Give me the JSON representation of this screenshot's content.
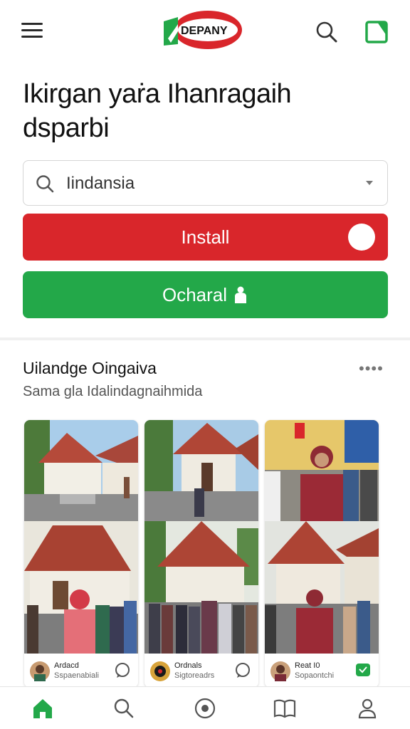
{
  "header": {
    "logo_text": "DEPANY",
    "menu_icon": "hamburger-menu-icon",
    "search_icon": "search-icon",
    "bookmark_icon": "bookmark-icon"
  },
  "page": {
    "title_line1": "Ikirgan yaṙa Ihanragaih",
    "title_line2": "dsparbi"
  },
  "select": {
    "value": "Iindansia",
    "icon": "search-icon"
  },
  "buttons": {
    "install_label": "Install",
    "download_label": "Ocharal"
  },
  "section": {
    "title": "Uilandge Oingaiva",
    "subtitle": "Sama gla Idalindagnaihmida",
    "more": "••••"
  },
  "cards": [
    {
      "name": "Ardacd",
      "sub": "Sspaenabiali",
      "action_icon": "chat-icon"
    },
    {
      "name": "Ordnals",
      "sub": "Sigtoreadrs",
      "action_icon": "chat-icon"
    },
    {
      "name": "Reat I0",
      "sub": "Sopaontchi",
      "action_icon": "message-icon"
    }
  ],
  "nav": {
    "home": "home-icon",
    "search": "search-icon",
    "discover": "compass-icon",
    "library": "book-icon",
    "profile": "profile-icon"
  },
  "colors": {
    "install": "#d9262b",
    "download": "#23a849",
    "accent_green": "#23a849"
  }
}
